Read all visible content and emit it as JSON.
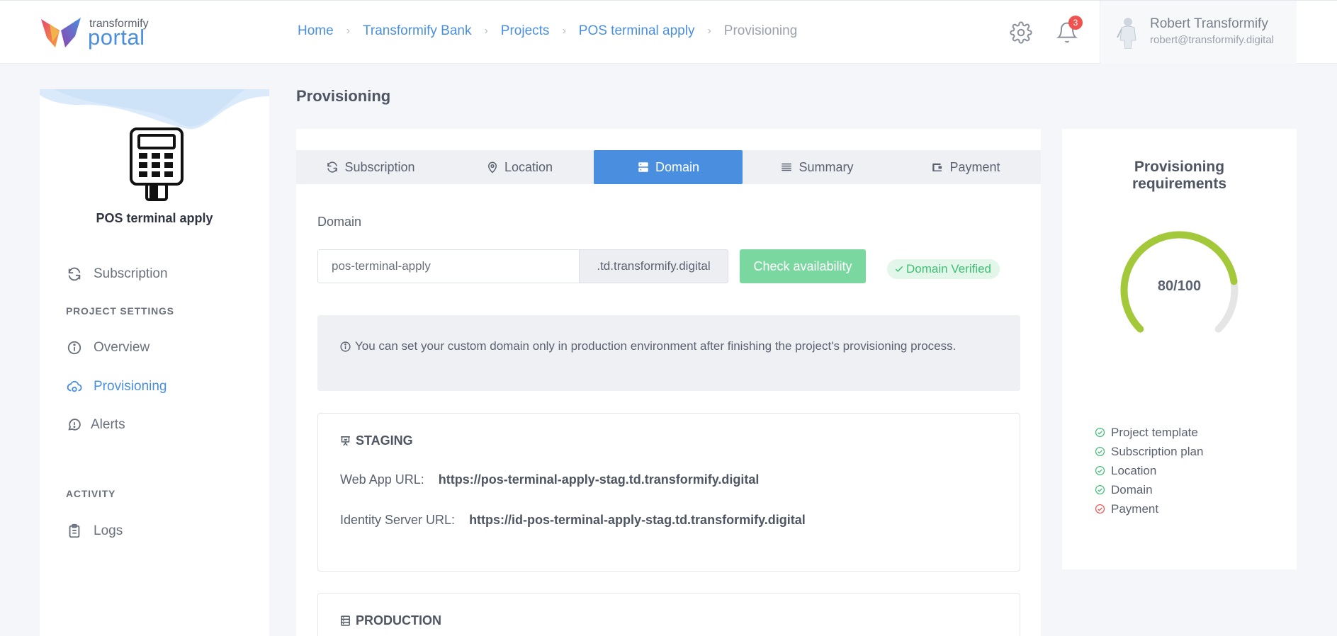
{
  "header": {
    "logo_top": "transformify",
    "logo_main": "portal",
    "breadcrumb": [
      "Home",
      "Transformify Bank",
      "Projects",
      "POS terminal apply",
      "Provisioning"
    ],
    "notification_count": "3",
    "user_name": "Robert Transformify",
    "user_email": "robert@transformify.digital"
  },
  "sidebar": {
    "project_name": "POS terminal apply",
    "subscription": "Subscription",
    "section_project": "PROJECT SETTINGS",
    "overview": "Overview",
    "provisioning": "Provisioning",
    "alerts": "Alerts",
    "section_activity": "ACTIVITY",
    "logs": "Logs"
  },
  "main": {
    "page_title": "Provisioning",
    "tabs": [
      {
        "label": "Subscription",
        "icon": "refresh-icon"
      },
      {
        "label": "Location",
        "icon": "map-pin-icon"
      },
      {
        "label": "Domain",
        "icon": "server-icon"
      },
      {
        "label": "Summary",
        "icon": "list-icon"
      },
      {
        "label": "Payment",
        "icon": "wallet-icon"
      }
    ],
    "active_tab": "Domain",
    "domain_label": "Domain",
    "domain_value": "pos-terminal-apply",
    "domain_suffix": ".td.transformify.digital",
    "check_button": "Check availability",
    "verified_label": "Domain Verified",
    "info_text": "You can set your custom domain only in production environment after finishing the project's provisioning process.",
    "staging": {
      "title": "STAGING",
      "web_label": "Web App URL:",
      "web_url": "https://pos-terminal-apply-stag.td.transformify.digital",
      "id_label": "Identity Server URL:",
      "id_url": "https://id-pos-terminal-apply-stag.td.transformify.digital"
    },
    "production": {
      "title": "PRODUCTION"
    }
  },
  "requirements": {
    "title_line1": "Provisioning",
    "title_line2": "requirements",
    "score_text": "80/100",
    "score": 80,
    "items": [
      {
        "label": "Project template",
        "done": true
      },
      {
        "label": "Subscription plan",
        "done": true
      },
      {
        "label": "Location",
        "done": true
      },
      {
        "label": "Domain",
        "done": true
      },
      {
        "label": "Payment",
        "done": false
      }
    ]
  },
  "colors": {
    "accent": "#4a8fdf",
    "success": "#3fbf73",
    "gauge": "#a3c93a",
    "error": "#ef5350"
  }
}
